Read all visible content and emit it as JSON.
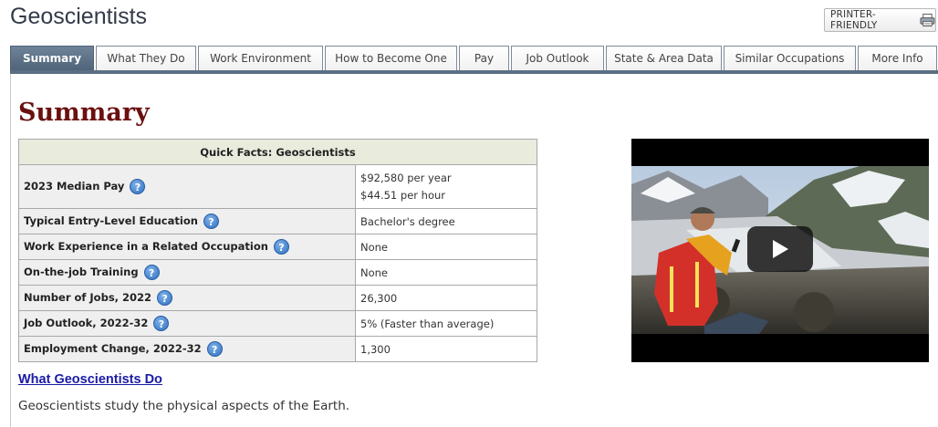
{
  "header": {
    "title": "Geoscientists",
    "printer_label": "PRINTER-FRIENDLY"
  },
  "tabs": [
    {
      "label": "Summary",
      "active": true
    },
    {
      "label": "What They Do"
    },
    {
      "label": "Work Environment"
    },
    {
      "label": "How to Become One"
    },
    {
      "label": "Pay"
    },
    {
      "label": "Job Outlook"
    },
    {
      "label": "State & Area Data"
    },
    {
      "label": "Similar Occupations"
    },
    {
      "label": "More Info"
    }
  ],
  "main": {
    "section_title": "Summary",
    "quick_facts": {
      "header": "Quick Facts: Geoscientists",
      "help_glyph": "?",
      "rows": [
        {
          "label": "2023 Median Pay",
          "value_lines": [
            "$92,580 per year",
            "$44.51 per hour"
          ]
        },
        {
          "label": "Typical Entry-Level Education",
          "value": "Bachelor's degree"
        },
        {
          "label": "Work Experience in a Related Occupation",
          "value": "None"
        },
        {
          "label": "On-the-job Training",
          "value": "None"
        },
        {
          "label": "Number of Jobs, 2022",
          "value": "26,300"
        },
        {
          "label": "Job Outlook, 2022-32",
          "value": "5% (Faster than average)"
        },
        {
          "label": "Employment Change, 2022-32",
          "value": "1,300"
        }
      ]
    },
    "what_they_do_link": "What Geoscientists Do",
    "what_they_do_text": "Geoscientists study the physical aspects of the Earth."
  },
  "colors": {
    "active_tab": "#5b6f84",
    "section_title": "#6b0f0f",
    "link": "#1a1aa6",
    "table_header_bg": "#e9ebdd"
  },
  "icons": [
    "printer-icon",
    "help-icon",
    "play-icon"
  ]
}
